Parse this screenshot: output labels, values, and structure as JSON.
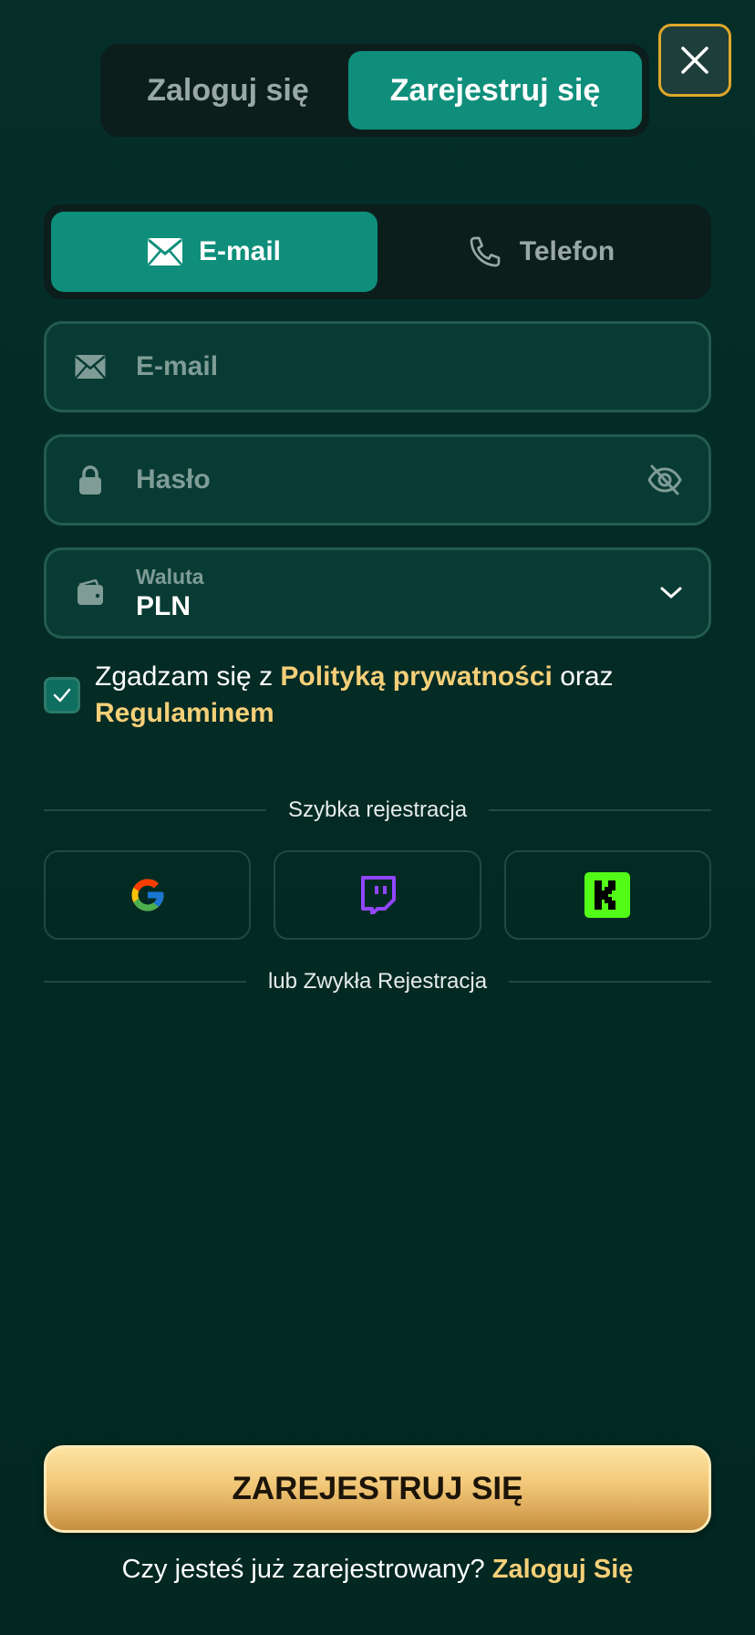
{
  "auth_tabs": {
    "login": "Zaloguj się",
    "register": "Zarejestruj się",
    "active": "register"
  },
  "close_icon": "close-icon",
  "method_tabs": {
    "email": "E-mail",
    "phone": "Telefon",
    "active": "email"
  },
  "form": {
    "email": {
      "placeholder": "E-mail",
      "value": ""
    },
    "password": {
      "placeholder": "Hasło",
      "value": ""
    },
    "currency": {
      "label": "Waluta",
      "value": "PLN"
    }
  },
  "consent": {
    "checked": true,
    "prefix": "Zgadzam się z ",
    "privacy_link": "Polityką prywatności",
    "middle": " oraz ",
    "terms_link": "Regulaminem"
  },
  "quick_signup": {
    "label": "Szybka rejestracja",
    "providers": [
      "google",
      "twitch",
      "kick"
    ]
  },
  "regular_divider": "lub Zwykła Rejestracja",
  "submit_label": "ZAREJESTRUJ SIĘ",
  "footer": {
    "question": "Czy jesteś już zarejestrowany? ",
    "login_link": "Zaloguj Się"
  },
  "colors": {
    "accent": "#0f8e7b",
    "gold": "#f5cf78",
    "background": "#032a22"
  }
}
